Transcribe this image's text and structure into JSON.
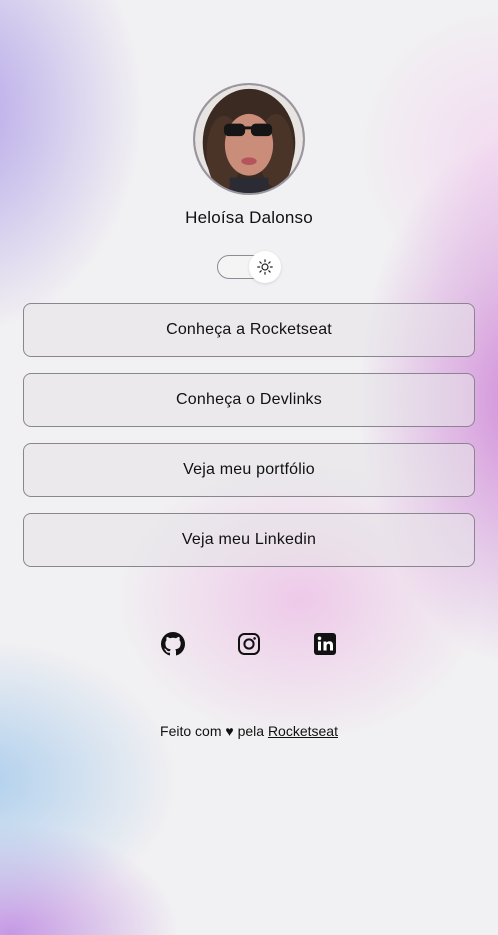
{
  "profile": {
    "name": "Heloísa Dalonso"
  },
  "theme_toggle": {
    "icon": "sun-icon"
  },
  "links": [
    {
      "label": "Conheça a Rocketseat"
    },
    {
      "label": "Conheça o Devlinks"
    },
    {
      "label": "Veja meu portfólio"
    },
    {
      "label": "Veja meu Linkedin"
    }
  ],
  "social": {
    "icons": [
      "github-icon",
      "instagram-icon",
      "linkedin-icon"
    ]
  },
  "footer": {
    "prefix": "Feito com ♥ pela ",
    "link_label": "Rocketseat"
  }
}
